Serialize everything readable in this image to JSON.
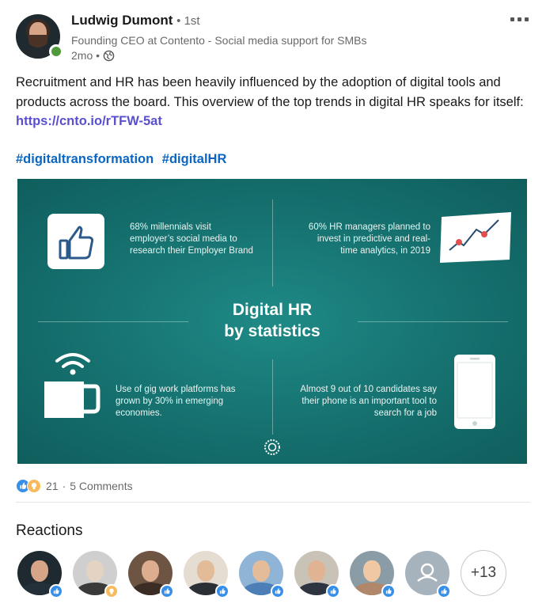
{
  "post": {
    "author": {
      "name": "Ludwig Dumont",
      "degree": "• 1st",
      "headline": "Founding CEO at Contento - Social media support for SMBs",
      "time": "2mo •",
      "online_status_color": "#4f9b3b"
    },
    "text": "Recruitment and HR has been heavily influenced by the adoption of digital tools and products across the board. This overview of the top trends in digital HR speaks for itself: ",
    "link": "https://cnto.io/rTFW-5at",
    "hashtags": [
      "#digitaltransformation",
      "#digitalHR"
    ],
    "more_icon": "three-dots-icon"
  },
  "infographic": {
    "title_line1": "Digital HR",
    "title_line2": "by statistics",
    "stats": {
      "top_left": "68% millennials visit employer’s social media to research their Employer Brand",
      "top_right": "60% HR managers planned to invest in predictive and real-time analytics, in 2019",
      "bottom_left": "Use of gig work platforms has grown by 30% in emerging economies.",
      "bottom_right": "Almost 9 out of 10 candidates say their phone is an important tool to search for a job"
    },
    "colors": {
      "background": "#15706e",
      "accent_red": "#e0504e"
    }
  },
  "social": {
    "reaction_count": "21",
    "comments": "5 Comments",
    "reaction_icons": [
      "like-icon",
      "insightful-icon"
    ]
  },
  "reactions": {
    "title": "Reactions",
    "more_count": "+13"
  }
}
